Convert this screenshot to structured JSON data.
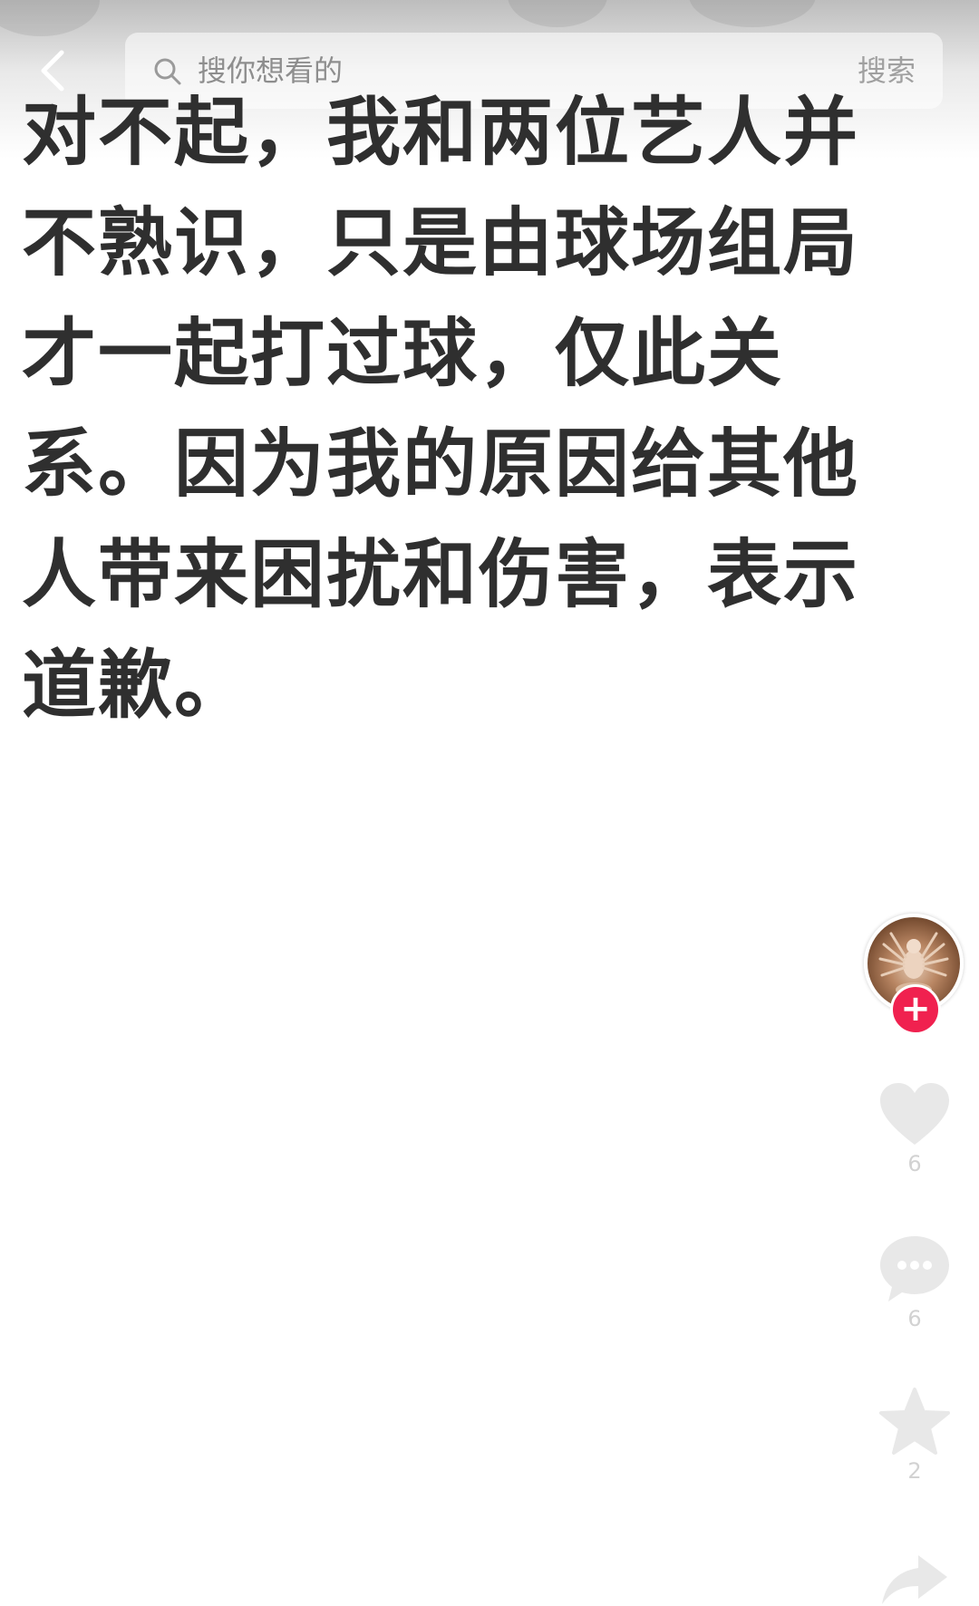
{
  "header": {
    "search": {
      "placeholder": "搜你想看的",
      "button_label": "搜索"
    }
  },
  "post": {
    "text": "对不起，我和两位艺人并\n不熟识，只是由球场组局\n才一起打过球，仅此关\n系。因为我的原因给其他\n人带来困扰和伤害，表示\n道歉。"
  },
  "sidebar": {
    "follow_label": "+",
    "likes": "6",
    "comments": "6",
    "favorites": "2"
  },
  "colors": {
    "follow_accent": "#f0214f",
    "text": "#2f2f2f",
    "icon": "#e6e6e6"
  }
}
